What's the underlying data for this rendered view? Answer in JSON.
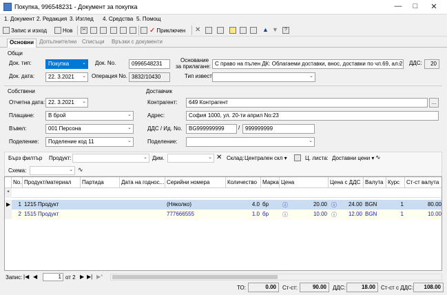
{
  "window": {
    "title": "Покупка, 996548231 - Документ за покупка"
  },
  "menu": [
    "1. Документ",
    "2. Редакция",
    "3. Изглед",
    "4. Средства",
    "5. Помощ"
  ],
  "toolbar": {
    "save_exit": "Запис и изход",
    "new": "Нов",
    "confirmed": "Приключен"
  },
  "tabs": [
    "Основни",
    "Допълнителни",
    "Списъци",
    "Връзки с документи"
  ],
  "general": {
    "section": "Общи",
    "doc_type_label": "Док. тип:",
    "doc_type": "Покупка",
    "doc_no_label": "Док. No.",
    "doc_no": "0996548231",
    "basis_label_1": "Основание",
    "basis_label_2": "за прилагане:",
    "basis": "С право на пълен ДК: Облагаеми доставки, внос, доставки по чл.69, ал.2",
    "vat_label": "ДДС:",
    "vat": "20",
    "doc_date_label": "Док. дата:",
    "doc_date": "22. 3.2021",
    "operation_label": "Операция No.",
    "operation": "3832/10430",
    "notice_label": "Тип известие:",
    "notice": ""
  },
  "own": {
    "section": "Собствени",
    "period_label": "Отчетна дата:",
    "period": "22. 3.2021",
    "payment_label": "Плащане:",
    "payment": "В брой",
    "entered_label": "Въвел:",
    "entered": "001 Персона",
    "division_label": "Поделение:",
    "division": "Поделение код 11"
  },
  "supplier": {
    "section": "Доставчик",
    "contragent_label": "Контрагент:",
    "contragent": "649 Контрагент",
    "address_label": "Адрес:",
    "address": "София 1000, ул. 20-ти април No:23",
    "vat_id_label": "ДДС / Ид. No.",
    "vat_no": "BG999999999",
    "id_no": "999999999",
    "division_label": "Поделение:",
    "division": ""
  },
  "filter": {
    "quick": "Бърз филтър",
    "product_label": "Продукт:",
    "dim_label": "Дим.",
    "store_label": "Склад:",
    "store": "Централен скл",
    "price_list_label": "Ц. листа:",
    "price_list": "Доставни цени",
    "scheme_label": "Схема:"
  },
  "table": {
    "headers": [
      "No.",
      "Продукт/материал",
      "Партида",
      "Дата на годнос...",
      "Серийни номера",
      "Количество",
      "Марка",
      "Цена",
      "Цена с ДДС",
      "Валута",
      "Курс",
      "Ст-ст валута"
    ],
    "rows": [
      {
        "no": "1",
        "product": "1215 Продукт",
        "lot": "",
        "date": "",
        "serial": "(Няколко)",
        "qty": "4.0",
        "unit": "бр",
        "price": "20.00",
        "price_vat": "24.00",
        "currency": "BGN",
        "rate": "1",
        "value": "80.00"
      },
      {
        "no": "2",
        "product": "1515 Продукт",
        "lot": "",
        "date": "",
        "serial": "777666555",
        "qty": "1.0",
        "unit": "бр",
        "price": "10.00",
        "price_vat": "12.00",
        "currency": "BGN",
        "rate": "1",
        "value": "10.00"
      }
    ]
  },
  "nav": {
    "record_label": "Запис:",
    "current": "1",
    "of": "от 2"
  },
  "totals": {
    "to_label": "ТО:",
    "to": "0.00",
    "cost_label": "Ст-ст:",
    "cost": "90.00",
    "vat_label": "ДДС:",
    "vat": "18.00",
    "cost_vat_label": "Ст-ст с ДДС:",
    "cost_vat": "108.00"
  },
  "colors": {
    "accent": "#0078d7",
    "row_selected": "#c9dcf2",
    "link": "#1a1aa6"
  }
}
